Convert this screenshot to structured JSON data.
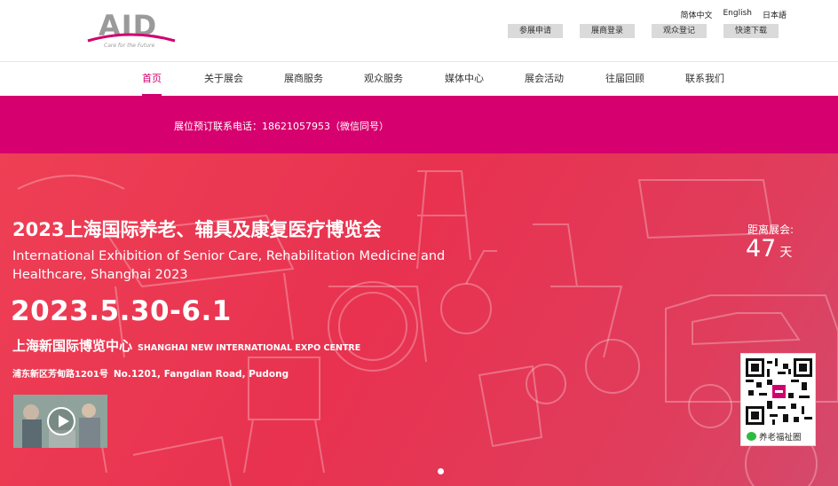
{
  "logo": {
    "wordmark": "AID",
    "tagline": "Care for the Future",
    "brand_color": "#d1006f"
  },
  "lang": {
    "zh": "简体中文",
    "en": "English",
    "ja": "日本語"
  },
  "quick": {
    "apply": "参展申请",
    "exhibitor_login": "展商登录",
    "visitor_register": "观众登记",
    "download": "快速下载"
  },
  "nav": {
    "home": "首页",
    "about": "关于展会",
    "exhibitor_service": "展商服务",
    "visitor_service": "观众服务",
    "media": "媒体中心",
    "events": "展会活动",
    "past": "往届回顾",
    "contact": "联系我们"
  },
  "notice": {
    "text": "展位预订联系电话：18621057953（微信同号）",
    "bg_color": "#d6006e"
  },
  "hero": {
    "title": "2023上海国际养老、辅具及康复医疗博览会",
    "title_en": "International Exhibition of Senior Care, Rehabilitation Medicine and Healthcare, Shanghai 2023",
    "date": "2023.5.30-6.1",
    "venue_cn": "上海新国际博览中心",
    "venue_en": "SHANGHAI NEW INTERNATIONAL EXPO CENTRE",
    "address_cn": "浦东新区芳甸路1201号",
    "address_en": "No.1201, Fangdian Road, Pudong",
    "countdown_label": "距离展会:",
    "countdown_value": "47",
    "countdown_unit": "天",
    "qr_caption": "养老福祉圈",
    "bg_color": "#e83250"
  }
}
